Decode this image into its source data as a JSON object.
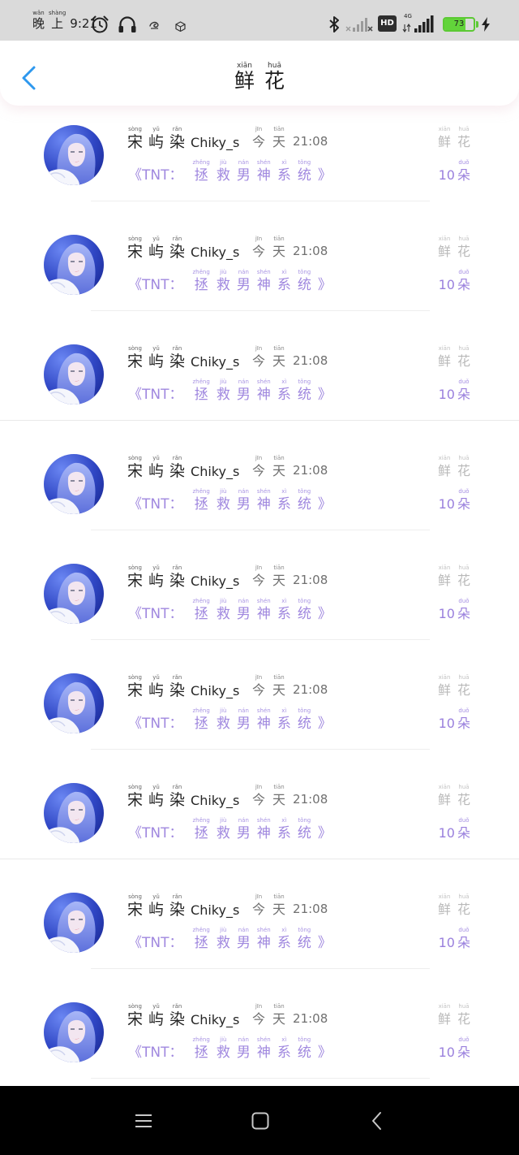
{
  "status_bar": {
    "period": [
      [
        "晚",
        "wǎn"
      ],
      [
        "上",
        "shàng"
      ]
    ],
    "time": "9:21",
    "hd_badge": "HD",
    "network": "4G",
    "battery_level": "73",
    "icons": [
      "alarm-clock-icon",
      "headphones-icon",
      "swirl-icon",
      "cube-icon",
      "bluetooth-icon",
      "signal-off-icon",
      "cellular-signal-icon",
      "battery-icon",
      "charging-bolt-icon"
    ]
  },
  "header": {
    "back_icon": "chevron-left-icon",
    "title": [
      [
        "鲜",
        "xiān"
      ],
      [
        "花",
        "huā"
      ]
    ]
  },
  "colors": {
    "accent_blue": "#2e98ee",
    "book_purple": "#a088df",
    "count_purple": "#9a80dd",
    "battery_green": "#5cc934",
    "status_bar_bg": "#dadada",
    "nav_bar_bg": "#000000"
  },
  "list": {
    "items": [
      {
        "name": [
          [
            "宋",
            "sòng"
          ],
          [
            "屿",
            "yǔ"
          ],
          [
            "染",
            "rǎn"
          ],
          [
            "Chiky_s"
          ]
        ],
        "time": [
          [
            "今",
            "jīn"
          ],
          [
            "天",
            "tiān"
          ],
          [
            "21:08"
          ]
        ],
        "gift": [
          [
            "鲜",
            "xiān"
          ],
          [
            "花",
            "huā"
          ]
        ],
        "book": [
          [
            "《TNT："
          ],
          [
            "拯",
            "zhěng"
          ],
          [
            "救",
            "jiù"
          ],
          [
            "男",
            "nán"
          ],
          [
            "神",
            "shén"
          ],
          [
            "系",
            "xì"
          ],
          [
            "统",
            "tǒng"
          ],
          [
            "》"
          ]
        ],
        "count": [
          [
            "10"
          ],
          [
            "朵",
            "duǒ"
          ]
        ]
      },
      {
        "name": [
          [
            "宋",
            "sòng"
          ],
          [
            "屿",
            "yǔ"
          ],
          [
            "染",
            "rǎn"
          ],
          [
            "Chiky_s"
          ]
        ],
        "time": [
          [
            "今",
            "jīn"
          ],
          [
            "天",
            "tiān"
          ],
          [
            "21:08"
          ]
        ],
        "gift": [
          [
            "鲜",
            "xiān"
          ],
          [
            "花",
            "huā"
          ]
        ],
        "book": [
          [
            "《TNT："
          ],
          [
            "拯",
            "zhěng"
          ],
          [
            "救",
            "jiù"
          ],
          [
            "男",
            "nán"
          ],
          [
            "神",
            "shén"
          ],
          [
            "系",
            "xì"
          ],
          [
            "统",
            "tǒng"
          ],
          [
            "》"
          ]
        ],
        "count": [
          [
            "10"
          ],
          [
            "朵",
            "duǒ"
          ]
        ]
      },
      {
        "name": [
          [
            "宋",
            "sòng"
          ],
          [
            "屿",
            "yǔ"
          ],
          [
            "染",
            "rǎn"
          ],
          [
            "Chiky_s"
          ]
        ],
        "time": [
          [
            "今",
            "jīn"
          ],
          [
            "天",
            "tiān"
          ],
          [
            "21:08"
          ]
        ],
        "gift": [
          [
            "鲜",
            "xiān"
          ],
          [
            "花",
            "huā"
          ]
        ],
        "book": [
          [
            "《TNT："
          ],
          [
            "拯",
            "zhěng"
          ],
          [
            "救",
            "jiù"
          ],
          [
            "男",
            "nán"
          ],
          [
            "神",
            "shén"
          ],
          [
            "系",
            "xì"
          ],
          [
            "统",
            "tǒng"
          ],
          [
            "》"
          ]
        ],
        "count": [
          [
            "10"
          ],
          [
            "朵",
            "duǒ"
          ]
        ]
      },
      {
        "name": [
          [
            "宋",
            "sòng"
          ],
          [
            "屿",
            "yǔ"
          ],
          [
            "染",
            "rǎn"
          ],
          [
            "Chiky_s"
          ]
        ],
        "time": [
          [
            "今",
            "jīn"
          ],
          [
            "天",
            "tiān"
          ],
          [
            "21:08"
          ]
        ],
        "gift": [
          [
            "鲜",
            "xiān"
          ],
          [
            "花",
            "huā"
          ]
        ],
        "book": [
          [
            "《TNT："
          ],
          [
            "拯",
            "zhěng"
          ],
          [
            "救",
            "jiù"
          ],
          [
            "男",
            "nán"
          ],
          [
            "神",
            "shén"
          ],
          [
            "系",
            "xì"
          ],
          [
            "统",
            "tǒng"
          ],
          [
            "》"
          ]
        ],
        "count": [
          [
            "10"
          ],
          [
            "朵",
            "duǒ"
          ]
        ]
      },
      {
        "name": [
          [
            "宋",
            "sòng"
          ],
          [
            "屿",
            "yǔ"
          ],
          [
            "染",
            "rǎn"
          ],
          [
            "Chiky_s"
          ]
        ],
        "time": [
          [
            "今",
            "jīn"
          ],
          [
            "天",
            "tiān"
          ],
          [
            "21:08"
          ]
        ],
        "gift": [
          [
            "鲜",
            "xiān"
          ],
          [
            "花",
            "huā"
          ]
        ],
        "book": [
          [
            "《TNT："
          ],
          [
            "拯",
            "zhěng"
          ],
          [
            "救",
            "jiù"
          ],
          [
            "男",
            "nán"
          ],
          [
            "神",
            "shén"
          ],
          [
            "系",
            "xì"
          ],
          [
            "统",
            "tǒng"
          ],
          [
            "》"
          ]
        ],
        "count": [
          [
            "10"
          ],
          [
            "朵",
            "duǒ"
          ]
        ]
      },
      {
        "name": [
          [
            "宋",
            "sòng"
          ],
          [
            "屿",
            "yǔ"
          ],
          [
            "染",
            "rǎn"
          ],
          [
            "Chiky_s"
          ]
        ],
        "time": [
          [
            "今",
            "jīn"
          ],
          [
            "天",
            "tiān"
          ],
          [
            "21:08"
          ]
        ],
        "gift": [
          [
            "鲜",
            "xiān"
          ],
          [
            "花",
            "huā"
          ]
        ],
        "book": [
          [
            "《TNT："
          ],
          [
            "拯",
            "zhěng"
          ],
          [
            "救",
            "jiù"
          ],
          [
            "男",
            "nán"
          ],
          [
            "神",
            "shén"
          ],
          [
            "系",
            "xì"
          ],
          [
            "统",
            "tǒng"
          ],
          [
            "》"
          ]
        ],
        "count": [
          [
            "10"
          ],
          [
            "朵",
            "duǒ"
          ]
        ]
      },
      {
        "name": [
          [
            "宋",
            "sòng"
          ],
          [
            "屿",
            "yǔ"
          ],
          [
            "染",
            "rǎn"
          ],
          [
            "Chiky_s"
          ]
        ],
        "time": [
          [
            "今",
            "jīn"
          ],
          [
            "天",
            "tiān"
          ],
          [
            "21:08"
          ]
        ],
        "gift": [
          [
            "鲜",
            "xiān"
          ],
          [
            "花",
            "huā"
          ]
        ],
        "book": [
          [
            "《TNT："
          ],
          [
            "拯",
            "zhěng"
          ],
          [
            "救",
            "jiù"
          ],
          [
            "男",
            "nán"
          ],
          [
            "神",
            "shén"
          ],
          [
            "系",
            "xì"
          ],
          [
            "统",
            "tǒng"
          ],
          [
            "》"
          ]
        ],
        "count": [
          [
            "10"
          ],
          [
            "朵",
            "duǒ"
          ]
        ]
      },
      {
        "name": [
          [
            "宋",
            "sòng"
          ],
          [
            "屿",
            "yǔ"
          ],
          [
            "染",
            "rǎn"
          ],
          [
            "Chiky_s"
          ]
        ],
        "time": [
          [
            "今",
            "jīn"
          ],
          [
            "天",
            "tiān"
          ],
          [
            "21:08"
          ]
        ],
        "gift": [
          [
            "鲜",
            "xiān"
          ],
          [
            "花",
            "huā"
          ]
        ],
        "book": [
          [
            "《TNT："
          ],
          [
            "拯",
            "zhěng"
          ],
          [
            "救",
            "jiù"
          ],
          [
            "男",
            "nán"
          ],
          [
            "神",
            "shén"
          ],
          [
            "系",
            "xì"
          ],
          [
            "统",
            "tǒng"
          ],
          [
            "》"
          ]
        ],
        "count": [
          [
            "10"
          ],
          [
            "朵",
            "duǒ"
          ]
        ]
      },
      {
        "name": [
          [
            "宋",
            "sòng"
          ],
          [
            "屿",
            "yǔ"
          ],
          [
            "染",
            "rǎn"
          ],
          [
            "Chiky_s"
          ]
        ],
        "time": [
          [
            "今",
            "jīn"
          ],
          [
            "天",
            "tiān"
          ],
          [
            "21:08"
          ]
        ],
        "gift": [
          [
            "鲜",
            "xiān"
          ],
          [
            "花",
            "huā"
          ]
        ],
        "book": [
          [
            "《TNT："
          ],
          [
            "拯",
            "zhěng"
          ],
          [
            "救",
            "jiù"
          ],
          [
            "男",
            "nán"
          ],
          [
            "神",
            "shén"
          ],
          [
            "系",
            "xì"
          ],
          [
            "统",
            "tǒng"
          ],
          [
            "》"
          ]
        ],
        "count": [
          [
            "10"
          ],
          [
            "朵",
            "duǒ"
          ]
        ]
      }
    ]
  },
  "nav_bar": {
    "icons": [
      "menu-icon",
      "home-square-icon",
      "back-chevron-icon"
    ]
  }
}
